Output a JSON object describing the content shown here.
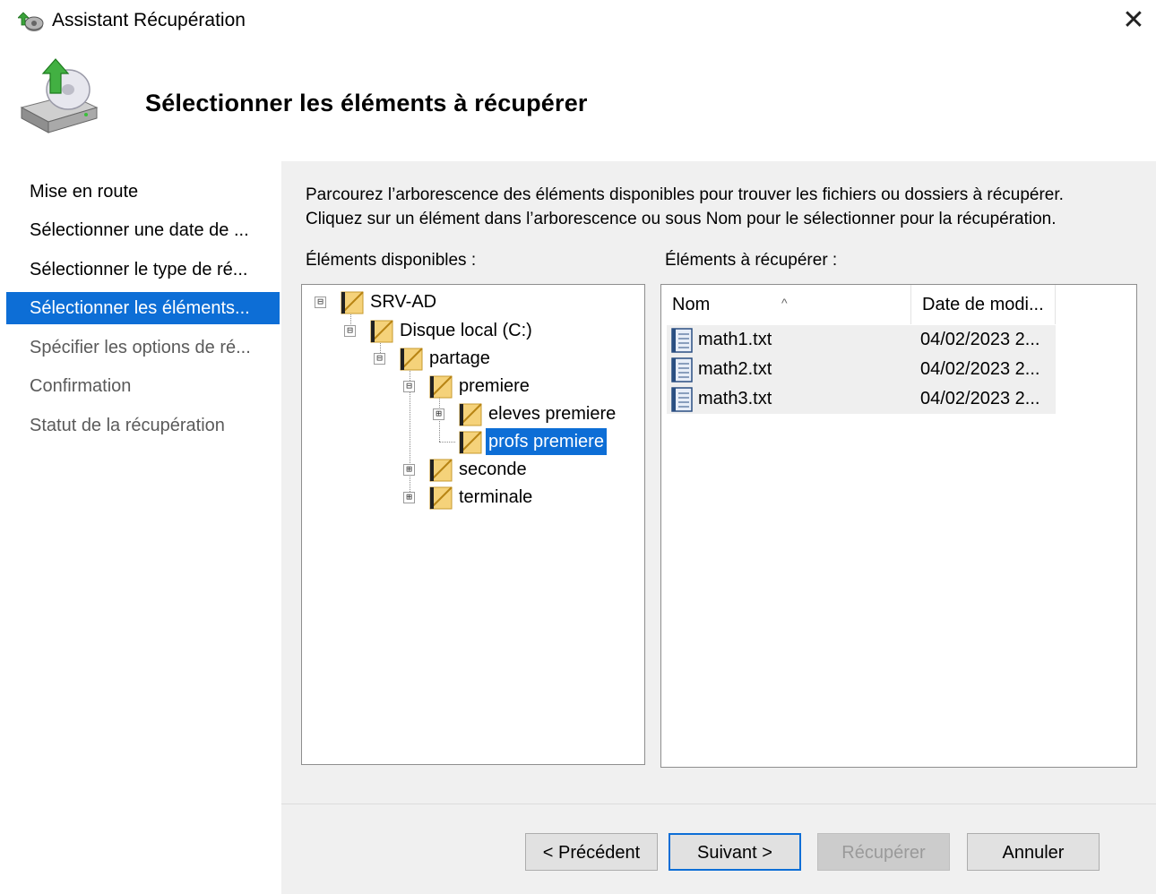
{
  "window": {
    "title": "Assistant Récupération",
    "close_glyph": "✕"
  },
  "header": {
    "title": "Sélectionner les éléments à récupérer",
    "icon": "backup-disk-restore-icon"
  },
  "nav": {
    "items": [
      {
        "label": "Mise en route",
        "state": "done"
      },
      {
        "label": "Sélectionner une date de ...",
        "state": "done"
      },
      {
        "label": "Sélectionner le type de ré...",
        "state": "done"
      },
      {
        "label": "Sélectionner les éléments...",
        "state": "active"
      },
      {
        "label": "Spécifier les options de ré...",
        "state": "pending"
      },
      {
        "label": "Confirmation",
        "state": "pending"
      },
      {
        "label": "Statut de la récupération",
        "state": "pending"
      }
    ]
  },
  "main": {
    "instructions": [
      "Parcourez l’arborescence des éléments disponibles pour trouver les fichiers ou dossiers à récupérer.",
      "Cliquez sur un élément dans l’arborescence ou sous Nom pour le sélectionner pour la récupération."
    ],
    "available_label": "Éléments disponibles :",
    "recover_label": "Éléments à récupérer :"
  },
  "tree": {
    "nodes": [
      {
        "label": "SRV-AD",
        "expander": "⊟",
        "selected": false
      },
      {
        "label": "Disque local (C:)",
        "expander": "⊟",
        "selected": false
      },
      {
        "label": "partage",
        "expander": "⊟",
        "selected": false
      },
      {
        "label": "premiere",
        "expander": "⊟",
        "selected": false
      },
      {
        "label": "eleves premiere",
        "expander": "⊞",
        "selected": false
      },
      {
        "label": "profs premiere",
        "expander": "",
        "selected": true
      },
      {
        "label": "seconde",
        "expander": "⊞",
        "selected": false
      },
      {
        "label": "terminale",
        "expander": "⊞",
        "selected": false
      }
    ]
  },
  "filelist": {
    "columns": {
      "name": "Nom",
      "date": "Date de modi..."
    },
    "sort_glyph": "^",
    "rows": [
      {
        "name": "math1.txt",
        "date": "04/02/2023 2..."
      },
      {
        "name": "math2.txt",
        "date": "04/02/2023 2..."
      },
      {
        "name": "math3.txt",
        "date": "04/02/2023 2..."
      }
    ]
  },
  "buttons": {
    "previous": "< Précédent",
    "next": "Suivant >",
    "recover": "Récupérer",
    "cancel": "Annuler"
  },
  "colors": {
    "accent": "#0d6ed6",
    "panel": "#f0f0f0"
  }
}
